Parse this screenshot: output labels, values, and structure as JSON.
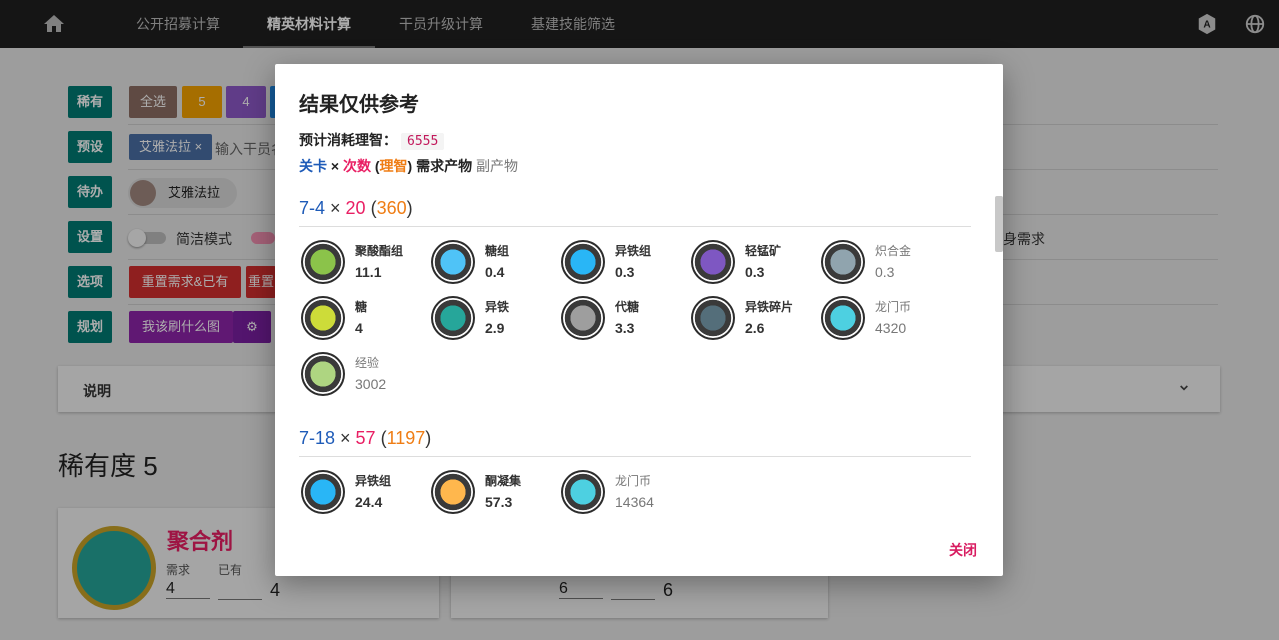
{
  "nav": {
    "tabs": [
      {
        "label": "公开招募计算"
      },
      {
        "label": "精英材料计算"
      },
      {
        "label": "干员升级计算"
      },
      {
        "label": "基建技能筛选"
      }
    ]
  },
  "page": {
    "rows": [
      {
        "label": "稀有"
      },
      {
        "label": "预设"
      },
      {
        "label": "待办"
      },
      {
        "label": "设置"
      },
      {
        "label": "选项"
      },
      {
        "label": "规划"
      }
    ],
    "rarity_buttons": [
      "全选",
      "5",
      "4"
    ],
    "preset_chip": "艾雅法拉",
    "preset_input_placeholder": "输入干员名",
    "todo_chip": "艾雅法拉",
    "setting_toggle_label": "简洁模式",
    "setting_right_label": "身需求",
    "option_buttons": [
      "重置需求&已有",
      "重置"
    ],
    "plan_button": "我该刷什么图",
    "explain_label": "说明",
    "rarity_heading": "稀有度 5",
    "card1": {
      "name": "聚合剂",
      "need_label": "需求",
      "have_label": "已有",
      "need_value": "4",
      "total": "4"
    },
    "card2": {
      "need_value": "6",
      "total": "6"
    }
  },
  "dialog": {
    "title": "结果仅供参考",
    "sanity_label": "预计消耗理智：",
    "sanity_value": "6555",
    "legend": {
      "stage": "关卡",
      "times_sign": "×",
      "count": "次数",
      "paren_open": "(",
      "sanity": "理智",
      "paren_close": ")",
      "need": "需求产物",
      "byproduct": "副产物"
    },
    "close_label": "关闭",
    "stages": [
      {
        "code": "7-4",
        "times": "20",
        "sanity": "360",
        "items": [
          {
            "name": "聚酸酯组",
            "value": "11.1",
            "byproduct": false,
            "icon": "polyester-pack-icon",
            "color": "#8bc34a"
          },
          {
            "name": "糖组",
            "value": "0.4",
            "byproduct": false,
            "icon": "sugar-pack-icon",
            "color": "#4fc3f7"
          },
          {
            "name": "异铁组",
            "value": "0.3",
            "byproduct": false,
            "icon": "oriron-cluster-icon",
            "color": "#29b6f6"
          },
          {
            "name": "轻锰矿",
            "value": "0.3",
            "byproduct": false,
            "icon": "manganese-ore-icon",
            "color": "#7e57c2"
          },
          {
            "name": "炽合金",
            "value": "0.3",
            "byproduct": true,
            "icon": "incandescent-alloy-icon",
            "color": "#90a4ae"
          },
          {
            "name": "糖",
            "value": "4",
            "byproduct": false,
            "icon": "sugar-icon",
            "color": "#cddc39"
          },
          {
            "name": "异铁",
            "value": "2.9",
            "byproduct": false,
            "icon": "oriron-icon",
            "color": "#26a69a"
          },
          {
            "name": "代糖",
            "value": "3.3",
            "byproduct": false,
            "icon": "sugar-substitute-icon",
            "color": "#9e9e9e"
          },
          {
            "name": "异铁碎片",
            "value": "2.6",
            "byproduct": false,
            "icon": "oriron-shard-icon",
            "color": "#546e7a"
          },
          {
            "name": "龙门币",
            "value": "4320",
            "byproduct": true,
            "icon": "lmd-icon",
            "color": "#4dd0e1"
          },
          {
            "name": "经验",
            "value": "3002",
            "byproduct": true,
            "icon": "exp-icon",
            "color": "#aed581"
          }
        ]
      },
      {
        "code": "7-18",
        "times": "57",
        "sanity": "1197",
        "items": [
          {
            "name": "异铁组",
            "value": "24.4",
            "byproduct": false,
            "icon": "oriron-cluster-icon",
            "color": "#29b6f6"
          },
          {
            "name": "酮凝集",
            "value": "57.3",
            "byproduct": false,
            "icon": "ketone-icon",
            "color": "#ffb74d"
          },
          {
            "name": "龙门币",
            "value": "14364",
            "byproduct": true,
            "icon": "lmd-icon",
            "color": "#4dd0e1"
          }
        ]
      }
    ]
  }
}
